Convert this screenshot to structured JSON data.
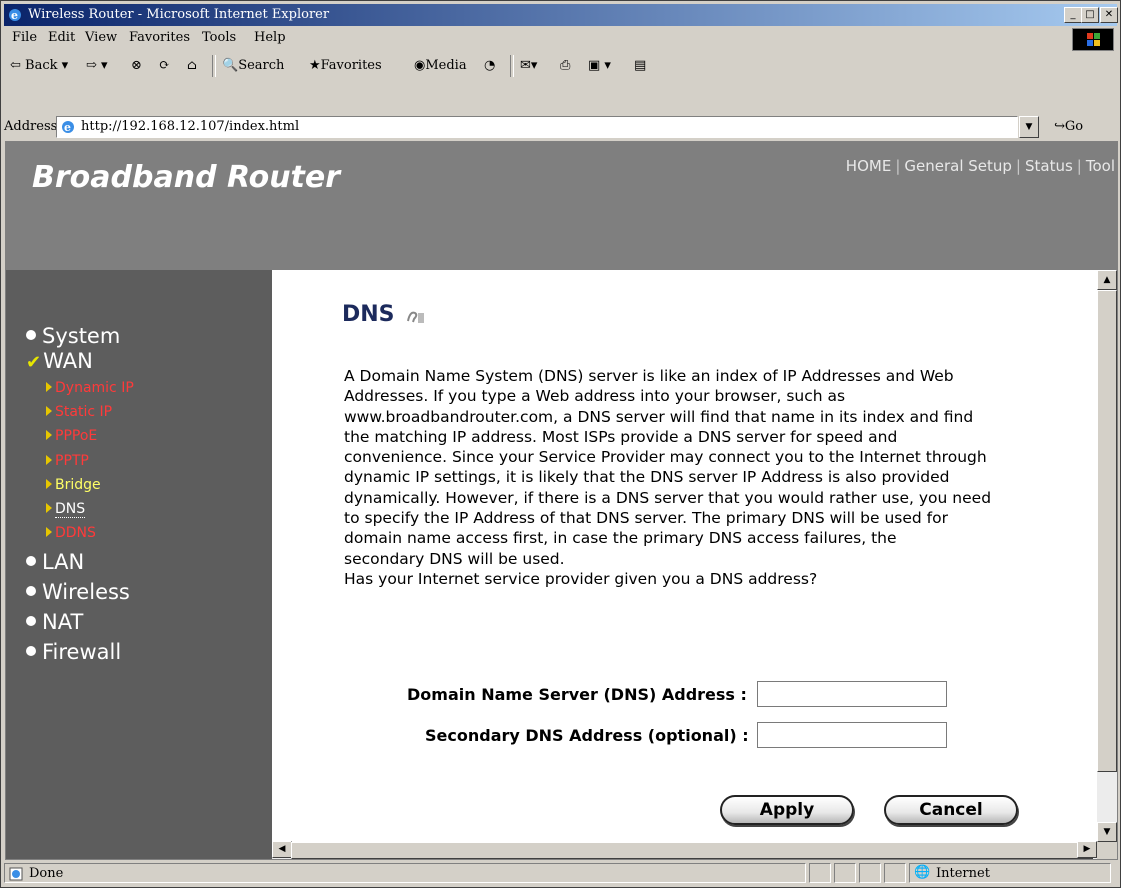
{
  "window": {
    "title": "Wireless Router - Microsoft Internet Explorer"
  },
  "menu": [
    "File",
    "Edit",
    "View",
    "Favorites",
    "Tools",
    "Help"
  ],
  "toolbar": {
    "back": "Back",
    "search": "Search",
    "favorites": "Favorites",
    "media": "Media"
  },
  "address": {
    "label": "Address",
    "url": "http://192.168.12.107/index.html",
    "go": "Go"
  },
  "header": {
    "brand": "Broadband Router",
    "nav": [
      "HOME",
      "General Setup",
      "Status",
      "Tool"
    ]
  },
  "sidebar": {
    "system": "System",
    "wan": "WAN",
    "wan_sub": [
      "Dynamic IP",
      "Static IP",
      "PPPoE",
      "PPTP",
      "Bridge",
      "DNS",
      "DDNS"
    ],
    "lan": "LAN",
    "wireless": "Wireless",
    "nat": "NAT",
    "firewall": "Firewall"
  },
  "content": {
    "title": "DNS",
    "description": "A Domain Name System (DNS) server is like an index of IP Addresses and Web\nAddresses. If you type a Web address into your browser, such as\nwww.broadbandrouter.com, a DNS server will find that name in its index and find\nthe matching IP address. Most ISPs provide a DNS server for speed and\nconvenience. Since your Service Provider may connect you to the Internet through\ndynamic IP settings, it is likely that the DNS server IP Address is also provided\ndynamically. However, if there is a DNS server that you would rather use, you need\nto specify the IP Address of that DNS server. The primary DNS will be used for\ndomain name access first, in case the primary DNS access failures, the\nsecondary DNS will be used.\nHas your Internet service provider given you a DNS address?",
    "dns_label": "Domain Name Server (DNS) Address :",
    "dns_value": "",
    "secondary_label": "Secondary DNS Address (optional) :",
    "secondary_value": "",
    "apply": "Apply",
    "cancel": "Cancel"
  },
  "status": {
    "text": "Done",
    "zone": "Internet"
  },
  "colors": {
    "header": "#7f7f7f",
    "sidebar": "#5d5d5d",
    "active_sub": "#ffffff",
    "inactive_sub": "#ff3a3a",
    "bridge_sub": "#ffff66",
    "title": "#1c2a5c"
  }
}
